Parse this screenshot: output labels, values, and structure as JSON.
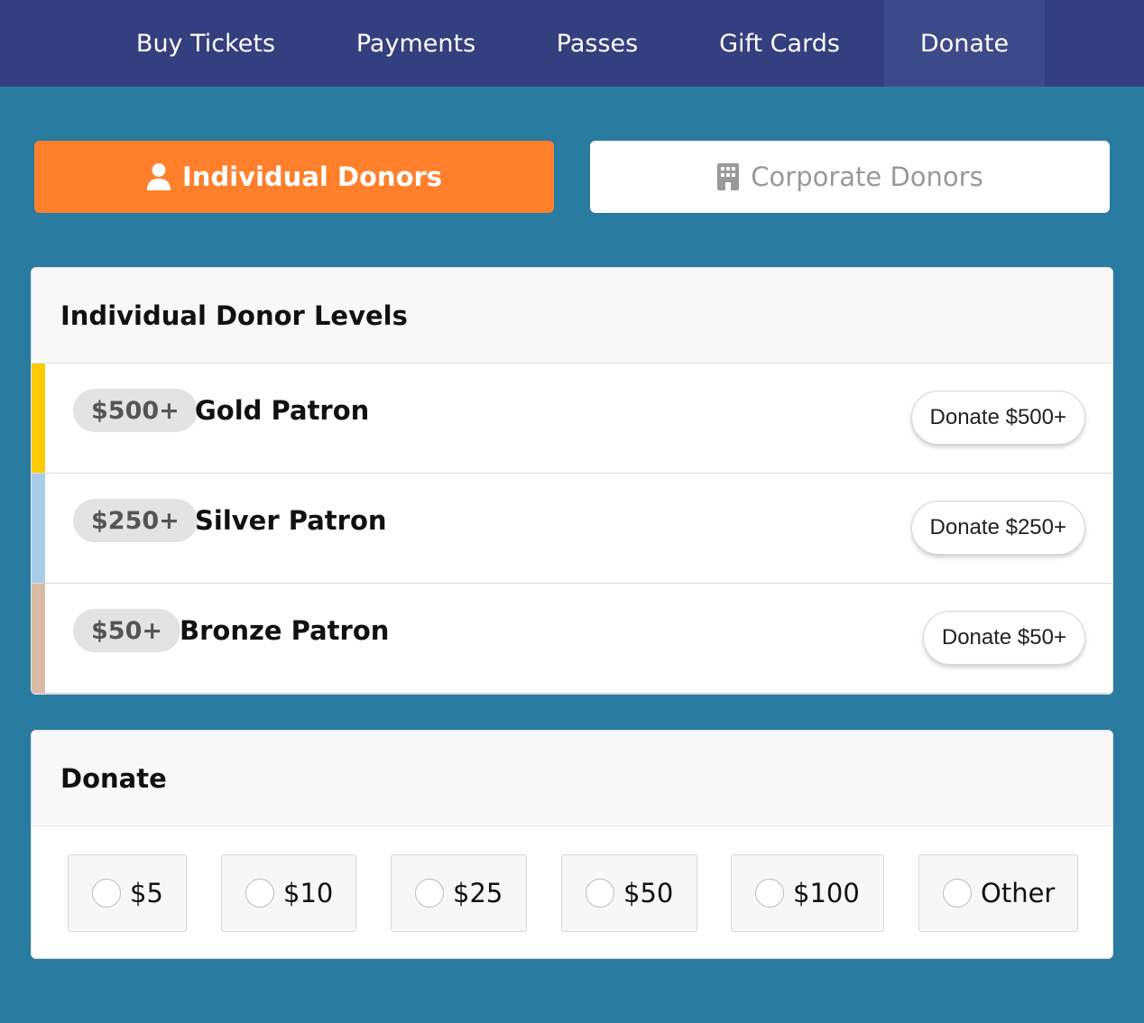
{
  "nav": {
    "items": [
      {
        "label": "Buy Tickets"
      },
      {
        "label": "Payments"
      },
      {
        "label": "Passes"
      },
      {
        "label": "Gift Cards"
      },
      {
        "label": "Donate",
        "active": true
      }
    ]
  },
  "donor_tabs": {
    "individual": {
      "label": "Individual Donors",
      "icon": "user-icon",
      "active": true
    },
    "corporate": {
      "label": "Corporate Donors",
      "icon": "building-icon",
      "active": false
    }
  },
  "levels": {
    "title": "Individual Donor Levels",
    "items": [
      {
        "badge": "$500+",
        "name": "Gold Patron",
        "button": "Donate $500+",
        "color": "#ffcc00"
      },
      {
        "badge": "$250+",
        "name": "Silver Patron",
        "button": "Donate $250+",
        "color": "#a9cde8"
      },
      {
        "badge": "$50+",
        "name": "Bronze Patron",
        "button": "Donate $50+",
        "color": "#d8bba2"
      }
    ]
  },
  "donate": {
    "title": "Donate",
    "options": [
      {
        "label": "$5",
        "selected": false
      },
      {
        "label": "$10",
        "selected": false
      },
      {
        "label": "$25",
        "selected": false
      },
      {
        "label": "$50",
        "selected": false
      },
      {
        "label": "$100",
        "selected": false
      },
      {
        "label": "Other",
        "selected": false
      }
    ]
  },
  "colors": {
    "page_background": "#2a7ba0",
    "nav_background": "#333f7e",
    "nav_active": "#3d4a8a",
    "accent_orange": "#ff7f2a"
  }
}
